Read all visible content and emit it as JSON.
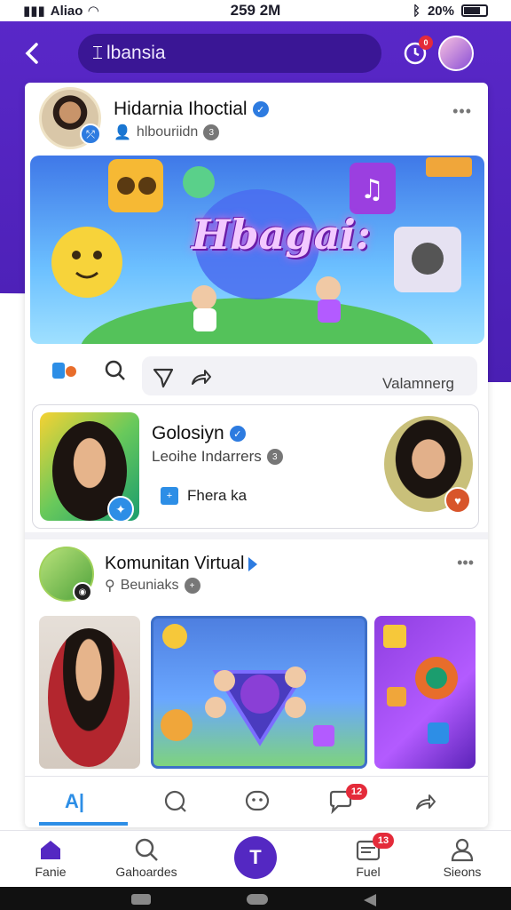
{
  "status_bar": {
    "carrier": "Aliao",
    "time": "259 2M",
    "battery": "20%"
  },
  "search": {
    "text": "lbansia"
  },
  "header_badge": "0",
  "post1": {
    "author": "Hidarnia Ihoctial",
    "subtitle": "hlbouriidn",
    "sub_count": "3",
    "banner_text": "Hbagai:"
  },
  "actions": {
    "label": "Valamnerg"
  },
  "suggestion": {
    "name": "Golosiyn",
    "subtitle": "Leoihe Indarrers",
    "sub_count": "3",
    "link": "Fhera ka"
  },
  "community": {
    "name": "Komunitan Virtual",
    "subtitle": "Beuniaks"
  },
  "post_tabs": {
    "badge": "12"
  },
  "bottom_nav": {
    "home": "Fanie",
    "search": "Gahoardes",
    "center": "T",
    "inbox": "Fuel",
    "inbox_badge": "13",
    "profile": "Sieons"
  },
  "colors": {
    "primary": "#5a28c9",
    "accent_blue": "#2d8ee6",
    "badge_red": "#e42b3a"
  }
}
